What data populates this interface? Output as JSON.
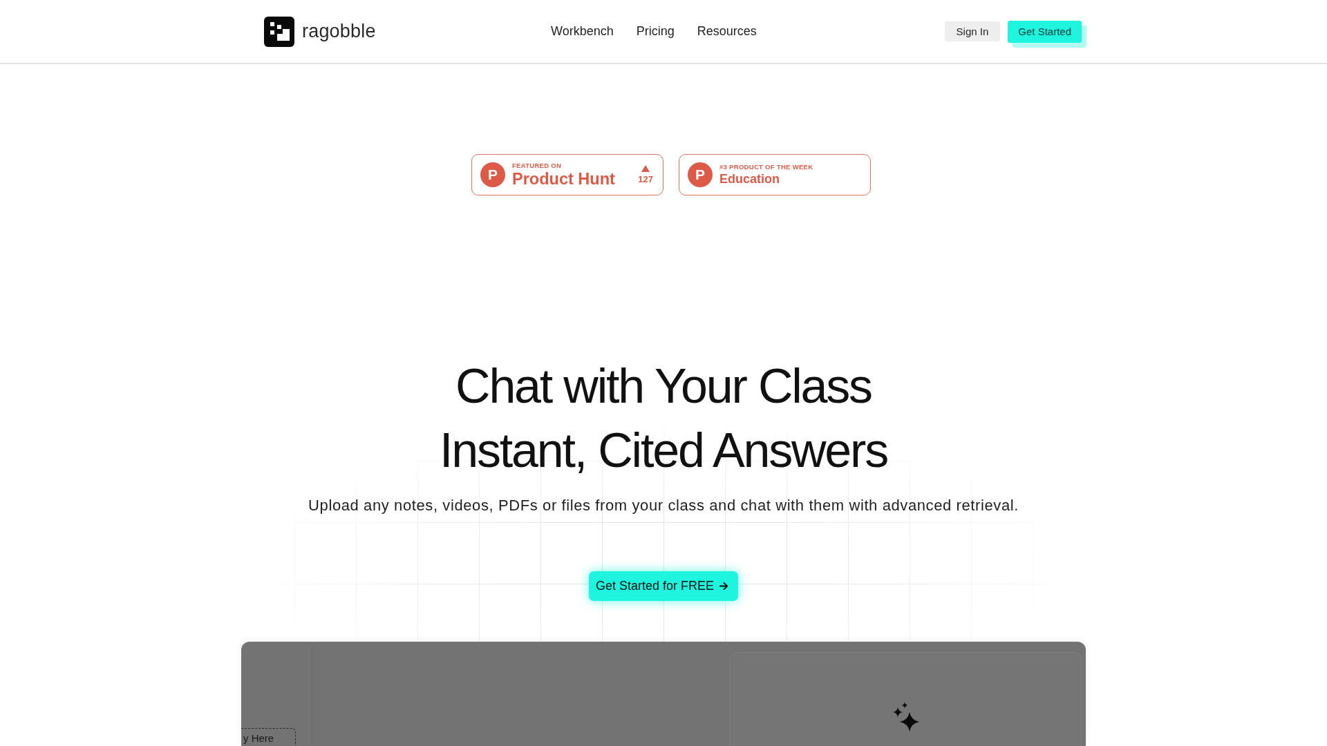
{
  "header": {
    "logo": {
      "text": "ragobble"
    },
    "nav": [
      {
        "label": "Workbench"
      },
      {
        "label": "Pricing"
      },
      {
        "label": "Resources"
      }
    ],
    "actions": [
      {
        "label": "Sign In",
        "kind": "secondary"
      },
      {
        "label": "Get Started",
        "kind": "primary"
      }
    ]
  },
  "badges": [
    {
      "kind": "featured",
      "mark": "P",
      "kicker": "FEATURED ON",
      "title": "Product Hunt",
      "votes": "127"
    },
    {
      "kind": "ranking",
      "mark": "P",
      "kicker": "#3 PRODUCT OF THE WEEK",
      "title": "Education"
    }
  ],
  "hero": {
    "title_lines": [
      "Chat with Your Class",
      "Instant, Cited Answers"
    ],
    "subtitle": "Upload any notes, videos, PDFs or files from your class and chat with them with advanced retrieval.",
    "cta": {
      "label": "Get Started for FREE"
    }
  },
  "preview": {
    "upload_zone": {
      "label": "y Here"
    }
  }
}
